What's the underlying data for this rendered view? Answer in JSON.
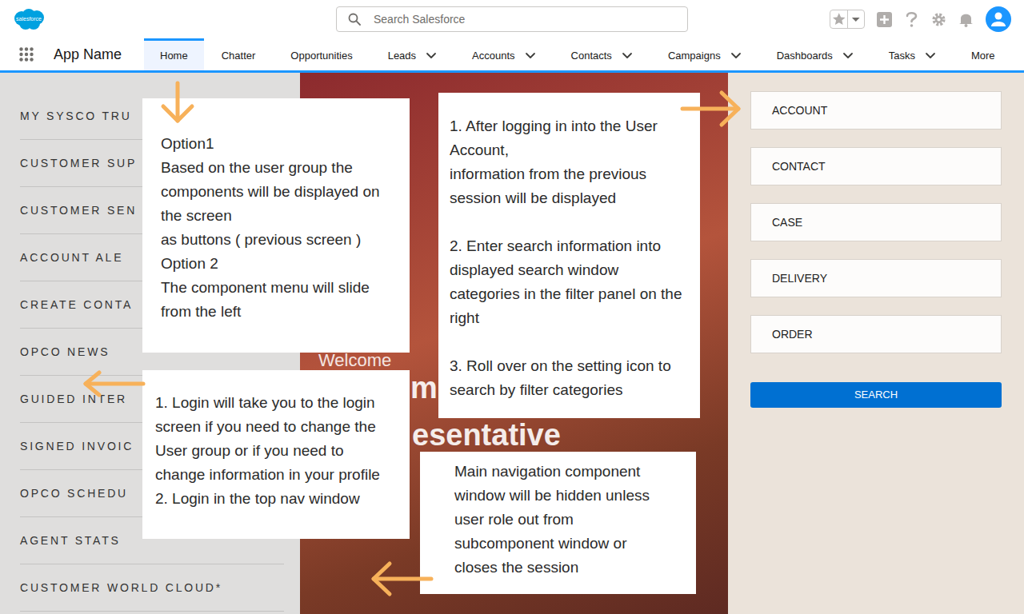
{
  "header": {
    "logo": "salesforce",
    "search_placeholder": "Search Salesforce"
  },
  "nav": {
    "app_name": "App Name",
    "tabs": [
      {
        "label": "Home",
        "selected": true,
        "has_menu": false
      },
      {
        "label": "Chatter",
        "selected": false,
        "has_menu": false
      },
      {
        "label": "Opportunities",
        "selected": false,
        "has_menu": false
      },
      {
        "label": "Leads",
        "selected": false,
        "has_menu": true
      },
      {
        "label": "Accounts",
        "selected": false,
        "has_menu": true
      },
      {
        "label": "Contacts",
        "selected": false,
        "has_menu": true
      },
      {
        "label": "Campaigns",
        "selected": false,
        "has_menu": true
      },
      {
        "label": "Dashboards",
        "selected": false,
        "has_menu": true
      },
      {
        "label": "Tasks",
        "selected": false,
        "has_menu": true
      },
      {
        "label": "More",
        "selected": false,
        "has_menu": false
      }
    ]
  },
  "sidebar": {
    "items": [
      "MY SYSCO TRU",
      "CUSTOMER SUP",
      "CUSTOMER SEN",
      "ACCOUNT ALE",
      "CREATE CONTA",
      "OPCO NEWS",
      "GUIDED INTER",
      "SIGNED INVOIC",
      "OPCO SCHEDU",
      "AGENT STATS",
      "CUSTOMER WORLD CLOUD*"
    ]
  },
  "welcome": [
    {
      "text": "Welcome",
      "kind": "caption"
    },
    {
      "text": "m",
      "kind": "title"
    },
    {
      "text": "esentative",
      "kind": "title"
    }
  ],
  "filters": {
    "fields": [
      "ACCOUNT",
      "CONTACT",
      "CASE",
      "DELIVERY",
      "ORDER"
    ],
    "button": "SEARCH"
  },
  "notes": [
    {
      "paragraphs": [
        [
          "Option1",
          "Based on the user group the",
          "components will be displayed on",
          "the screen",
          "as buttons ( previous screen )",
          "Option 2",
          "The component menu will slide",
          "from the left"
        ]
      ]
    },
    {
      "paragraphs": [
        [
          "1. After logging in into the User",
          "Account,",
          "information from the previous",
          "session will be displayed"
        ],
        [
          "2. Enter search information into",
          "displayed search window",
          "categories in the filter panel on the",
          "right"
        ],
        [
          "3. Roll over on the setting icon to",
          "search by filter categories"
        ]
      ]
    },
    {
      "paragraphs": [
        [
          "1. Login will take you to the login",
          "screen if you need to change the",
          "User group or if you need to",
          "change information in your profile",
          "2. Login in the top nav window"
        ]
      ]
    },
    {
      "paragraphs": [
        [
          "Main navigation component",
          "window will be hidden unless",
          "user role out from",
          "subcomponent window or",
          "closes the session"
        ]
      ]
    }
  ]
}
